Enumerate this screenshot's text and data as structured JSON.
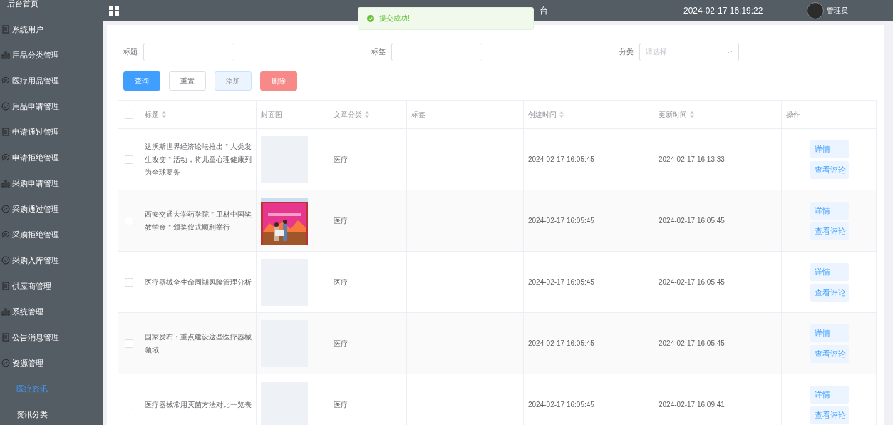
{
  "sidebar": {
    "items": [
      {
        "label": "后台首页",
        "kind": "plain"
      },
      {
        "label": "系统用户",
        "kind": "doc"
      },
      {
        "label": "用品分类管理",
        "kind": "bars"
      },
      {
        "label": "医疗用品管理",
        "kind": "chat"
      },
      {
        "label": "用品申请管理",
        "kind": "check"
      },
      {
        "label": "申请通过管理",
        "kind": "doc"
      },
      {
        "label": "申请拒绝管理",
        "kind": "chat"
      },
      {
        "label": "采购申请管理",
        "kind": "bars"
      },
      {
        "label": "采购通过管理",
        "kind": "check"
      },
      {
        "label": "采购拒绝管理",
        "kind": "chat"
      },
      {
        "label": "采购入库管理",
        "kind": "check"
      },
      {
        "label": "供应商管理",
        "kind": "doc"
      },
      {
        "label": "系统管理",
        "kind": "bars"
      },
      {
        "label": "公告消息管理",
        "kind": "doc"
      },
      {
        "label": "资源管理",
        "kind": "check",
        "children": [
          {
            "label": "医疗资讯",
            "selected": true
          },
          {
            "label": "资讯分类",
            "selected": false
          }
        ]
      }
    ]
  },
  "header": {
    "title": "台",
    "datetime": "2024-02-17 16:19:22",
    "user": "管理员"
  },
  "toast": {
    "text": "提交成功!"
  },
  "filters": [
    {
      "label": "标题",
      "kind": "input"
    },
    {
      "label": "标签",
      "kind": "input"
    },
    {
      "label": "分类",
      "kind": "select",
      "placeholder": "请选择"
    }
  ],
  "buttons": [
    {
      "label": "查询",
      "kind": "primary"
    },
    {
      "label": "重置",
      "kind": "plain"
    },
    {
      "label": "添加",
      "kind": "hover"
    },
    {
      "label": "删除",
      "kind": "danger"
    }
  ],
  "table": {
    "all_checked": false,
    "columns": [
      {
        "label": "标题",
        "sortable": true
      },
      {
        "label": "封面图",
        "sortable": false
      },
      {
        "label": "文章分类",
        "sortable": true
      },
      {
        "label": "标签",
        "sortable": false
      },
      {
        "label": "创建时间",
        "sortable": true
      },
      {
        "label": "更新时间",
        "sortable": true
      },
      {
        "label": "操作",
        "sortable": false
      }
    ],
    "rows": [
      {
        "checked": false,
        "title": "达沃斯世界经济论坛推出＂人类发生改变＂活动，将儿童心理健康列为全球要务",
        "cover": {
          "kind": "placeholder"
        },
        "category": "医疗",
        "created": "2024-02-17 16:05:45",
        "updated": "2024-02-17 16:13:33",
        "actions": [
          "详情",
          "查看评论"
        ]
      },
      {
        "checked": false,
        "title": "西安交通大学药学院＂卫材中国奖教学金＂颁奖仪式顺利举行",
        "cover": {
          "kind": "picture"
        },
        "category": "医疗",
        "created": "2024-02-17 16:05:45",
        "updated": "2024-02-17 16:05:45",
        "actions": [
          "详情",
          "查看评论"
        ]
      },
      {
        "checked": false,
        "title": "医疗器械全生命周期风险管理分析",
        "cover": {
          "kind": "placeholder"
        },
        "category": "医疗",
        "created": "2024-02-17 16:05:45",
        "updated": "2024-02-17 16:05:45",
        "actions": [
          "详情",
          "查看评论"
        ]
      },
      {
        "checked": false,
        "title": "国家发布：重点建设这些医疗器械领域",
        "cover": {
          "kind": "placeholder"
        },
        "category": "医疗",
        "created": "2024-02-17 16:05:45",
        "updated": "2024-02-17 16:05:45",
        "actions": [
          "详情",
          "查看评论"
        ]
      },
      {
        "checked": false,
        "title": "医疗器械常用灭菌方法对比一览表",
        "cover": {
          "kind": "placeholder"
        },
        "category": "医疗",
        "created": "2024-02-17 16:05:45",
        "updated": "2024-02-17 16:09:41",
        "actions": [
          "详情",
          "查看评论"
        ]
      }
    ]
  }
}
